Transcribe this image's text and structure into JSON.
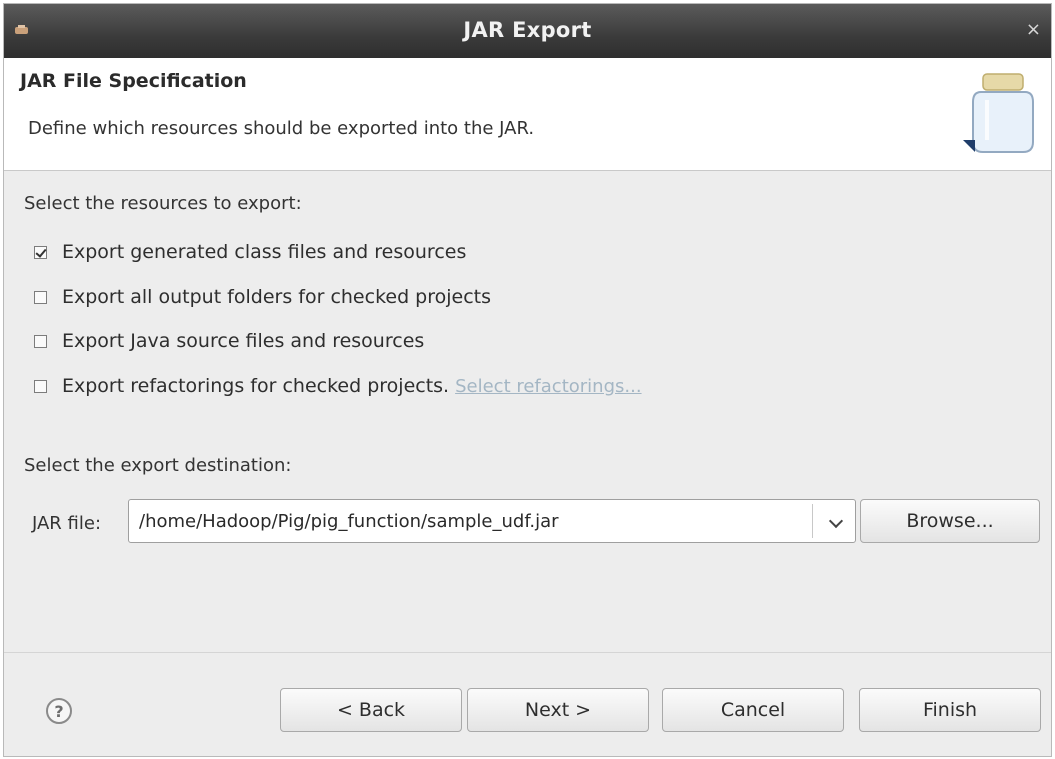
{
  "window": {
    "title": "JAR Export",
    "close_glyph": "×"
  },
  "header": {
    "title": "JAR File Specification",
    "description": "Define which resources should be exported into the JAR.",
    "icon": "jar-icon"
  },
  "resources": {
    "label": "Select the resources to export:",
    "options": [
      {
        "label": "Export generated class files and resources",
        "checked": true
      },
      {
        "label": "Export all output folders for checked projects",
        "checked": false
      },
      {
        "label": "Export Java source files and resources",
        "checked": false
      },
      {
        "label": "Export refactorings for checked projects.",
        "checked": false
      }
    ],
    "refactorings_link": "Select refactorings..."
  },
  "destination": {
    "label": "Select the export destination:",
    "jar_label": "JAR file:",
    "jar_value": "/home/Hadoop/Pig/pig_function/sample_udf.jar",
    "browse_label": "Browse..."
  },
  "footer": {
    "help_glyph": "?",
    "back_label": "< Back",
    "next_label": "Next >",
    "cancel_label": "Cancel",
    "finish_label": "Finish"
  }
}
